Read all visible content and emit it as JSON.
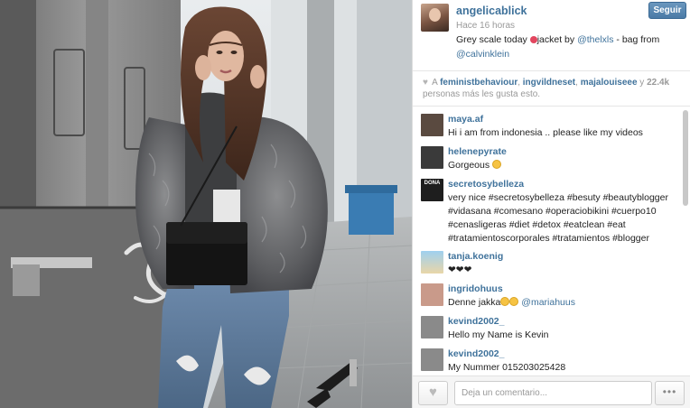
{
  "post": {
    "username": "angelicablick",
    "follow_label": "Seguir",
    "timestamp": "Hace 16 horas",
    "caption": {
      "pre": "Grey scale today ",
      "mid": "jacket by ",
      "mention1": "@thelxls",
      "post": " - bag from ",
      "mention2": "@calvinklein"
    }
  },
  "likes": {
    "user1": "feministbehaviour",
    "sep1": ", ",
    "user2": "ingvildneset",
    "sep2": ", ",
    "user3": "majalouiseee",
    "and": " y ",
    "count": "22.4k",
    "suffix": " personas más les gusta esto."
  },
  "comments": [
    {
      "user": "maya.af",
      "text": "Hi i am from indonesia .. please like my videos",
      "avatar_color": "#5a4a40"
    },
    {
      "user": "helenepyrate",
      "text": "Gorgeous ",
      "emoji": true,
      "avatar_color": "#3a3a3a"
    },
    {
      "user": "secretosybelleza",
      "text": "very nice #secretosybelleza #besuty #beautyblogger #vidasana #comesano #operaciobikini #cuerpo10 #cenasligeras #diet #detox #eatclean #eat #tratamientoscorporales #tratamientos #blogger",
      "avatar_color": "#1e1e1e",
      "avatar_label": "DONA"
    },
    {
      "user": "tanja.koenig",
      "text": "❤❤❤",
      "avatar_color": "#7fb2d6"
    },
    {
      "user": "ingridohuus",
      "text": "Denne jakka",
      "mention": "@mariahuus",
      "emoji2": true,
      "avatar_color": "#c99a8a"
    },
    {
      "user": "kevind2002_",
      "text": "Hello my Name is Kevin",
      "avatar_color": "#8a8a8a"
    },
    {
      "user": "kevind2002_",
      "text": "My Nummer 015203025428",
      "avatar_color": "#8a8a8a"
    }
  ],
  "footer": {
    "comment_placeholder": "Deja un comentario...",
    "more_label": "•••",
    "like_icon": "heart-icon"
  },
  "colors": {
    "link": "#3f729b",
    "follow_button": "#5b89b3",
    "muted": "#999999"
  }
}
